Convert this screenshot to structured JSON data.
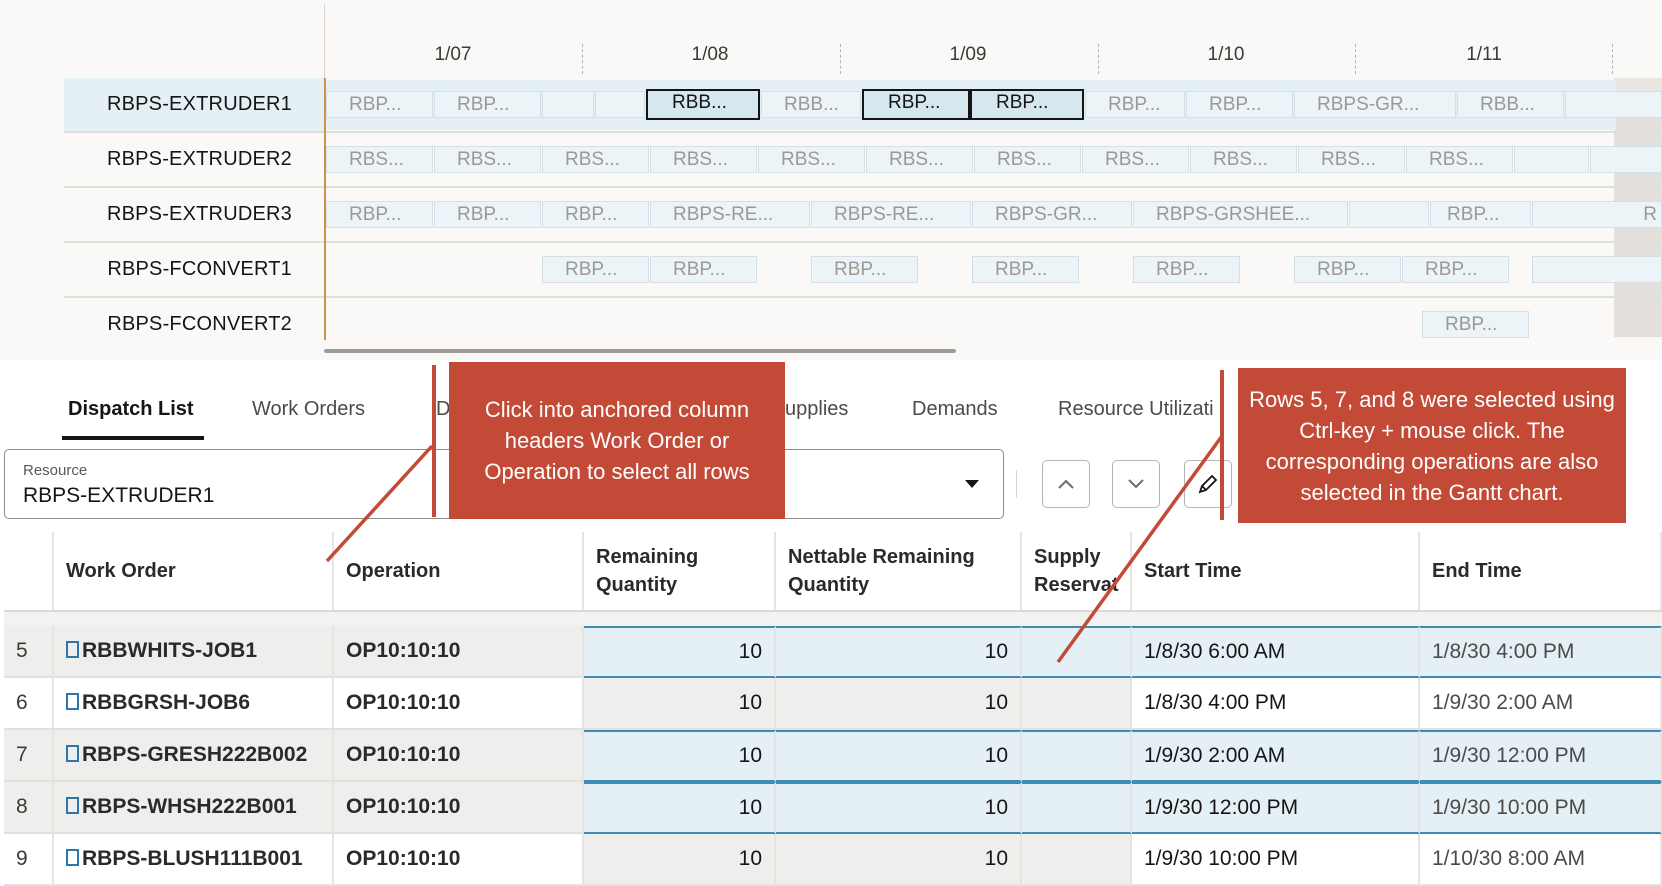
{
  "gantt": {
    "dates": [
      "1/07",
      "1/08",
      "1/09",
      "1/10",
      "1/11"
    ],
    "resources": [
      {
        "name": "RBPS-EXTRUDER1",
        "selected": true,
        "bars": [
          {
            "label": "RBP..."
          },
          {
            "label": "RBP..."
          },
          {
            "label": ""
          },
          {
            "label": ""
          },
          {
            "label": "RBB...",
            "selected": true
          },
          {
            "label": "RBB..."
          },
          {
            "label": "RBP...",
            "selected": true
          },
          {
            "label": "RBP...",
            "selected": true
          },
          {
            "label": "RBP..."
          },
          {
            "label": "RBP..."
          },
          {
            "label": "RBPS-GR..."
          },
          {
            "label": "RBB..."
          },
          {
            "label": ""
          }
        ]
      },
      {
        "name": "RBPS-EXTRUDER2",
        "bars": [
          {
            "label": "RBS..."
          },
          {
            "label": "RBS..."
          },
          {
            "label": "RBS..."
          },
          {
            "label": "RBS..."
          },
          {
            "label": "RBS..."
          },
          {
            "label": "RBS..."
          },
          {
            "label": "RBS..."
          },
          {
            "label": "RBS..."
          },
          {
            "label": "RBS..."
          },
          {
            "label": "RBS..."
          },
          {
            "label": "RBS..."
          },
          {
            "label": ""
          },
          {
            "label": ""
          }
        ]
      },
      {
        "name": "RBPS-EXTRUDER3",
        "bars": [
          {
            "label": "RBP..."
          },
          {
            "label": "RBP..."
          },
          {
            "label": "RBP..."
          },
          {
            "label": "RBPS-RE..."
          },
          {
            "label": "RBPS-RE..."
          },
          {
            "label": "RBPS-GR..."
          },
          {
            "label": "RBPS-GRSHEE..."
          },
          {
            "label": ""
          },
          {
            "label": "RBP..."
          },
          {
            "label": "R"
          }
        ]
      },
      {
        "name": "RBPS-FCONVERT1",
        "bars": [
          {
            "label": "RBP..."
          },
          {
            "label": "RBP..."
          },
          {
            "label": "RBP..."
          },
          {
            "label": "RBP..."
          },
          {
            "label": "RBP..."
          },
          {
            "label": "RBP..."
          },
          {
            "label": "RBP..."
          },
          {
            "label": ""
          }
        ]
      },
      {
        "name": "RBPS-FCONVERT2",
        "bars": [
          {
            "label": "RBP..."
          }
        ]
      }
    ]
  },
  "tabs": [
    {
      "label": "Dispatch List",
      "active": true
    },
    {
      "label": "Work Orders"
    },
    {
      "label": "D"
    },
    {
      "label": "upplies"
    },
    {
      "label": "Demands"
    },
    {
      "label": "Resource Utilizati"
    }
  ],
  "resource_field": {
    "label": "Resource",
    "value": "RBPS-EXTRUDER1"
  },
  "icons": {
    "move_up": "chevron-up-icon",
    "move_down": "chevron-down-icon",
    "edit": "pencil-icon"
  },
  "table": {
    "headers": {
      "work_order": "Work Order",
      "operation": "Operation",
      "remaining_qty": "Remaining Quantity",
      "nettable_qty": "Nettable Remaining Quantity",
      "supply_res": "Supply Reservat",
      "start_time": "Start Time",
      "end_time": "End Time"
    },
    "rows": [
      {
        "num": "5",
        "work_order": "RBBWHITS-JOB1",
        "operation": "OP10:10:10",
        "remaining": "10",
        "nettable": "10",
        "start": "1/8/30 6:00 AM",
        "end": "1/8/30 4:00 PM",
        "selected": true
      },
      {
        "num": "6",
        "work_order": "RBBGRSH-JOB6",
        "operation": "OP10:10:10",
        "remaining": "10",
        "nettable": "10",
        "start": "1/8/30 4:00 PM",
        "end": "1/9/30 2:00 AM",
        "selected": false
      },
      {
        "num": "7",
        "work_order": "RBPS-GRESH222B002",
        "operation": "OP10:10:10",
        "remaining": "10",
        "nettable": "10",
        "start": "1/9/30 2:00 AM",
        "end": "1/9/30 12:00 PM",
        "selected": true
      },
      {
        "num": "8",
        "work_order": "RBPS-WHSH222B001",
        "operation": "OP10:10:10",
        "remaining": "10",
        "nettable": "10",
        "start": "1/9/30 12:00 PM",
        "end": "1/9/30 10:00 PM",
        "selected": true
      },
      {
        "num": "9",
        "work_order": "RBPS-BLUSH111B001",
        "operation": "OP10:10:10",
        "remaining": "10",
        "nettable": "10",
        "start": "1/9/30 10:00 PM",
        "end": "1/10/30 8:00 AM",
        "selected": false
      }
    ]
  },
  "callouts": {
    "left": "Click into anchored column headers Work Order or Operation to select all rows",
    "right": "Rows 5, 7, and 8 were selected using Ctrl-key + mouse click. The corresponding operations are also selected in the Gantt chart."
  },
  "colors": {
    "callout": "#c34a36",
    "selection": "#e4f0f5",
    "selection_border": "#3e8cb3"
  }
}
